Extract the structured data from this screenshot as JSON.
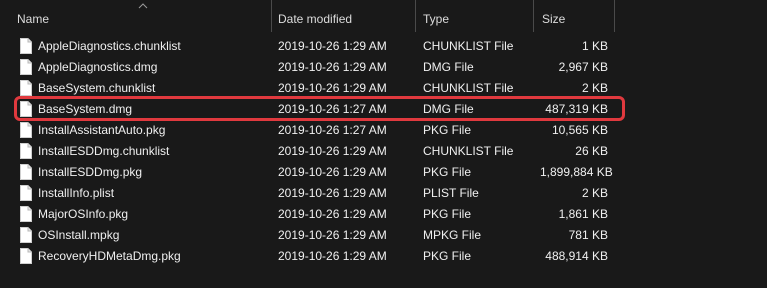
{
  "header": {
    "name": "Name",
    "date": "Date modified",
    "type": "Type",
    "size": "Size"
  },
  "files": [
    {
      "name": "AppleDiagnostics.chunklist",
      "date": "2019-10-26 1:29 AM",
      "type": "CHUNKLIST File",
      "size": "1 KB"
    },
    {
      "name": "AppleDiagnostics.dmg",
      "date": "2019-10-26 1:29 AM",
      "type": "DMG File",
      "size": "2,967 KB"
    },
    {
      "name": "BaseSystem.chunklist",
      "date": "2019-10-26 1:29 AM",
      "type": "CHUNKLIST File",
      "size": "2 KB"
    },
    {
      "name": "BaseSystem.dmg",
      "date": "2019-10-26 1:27 AM",
      "type": "DMG File",
      "size": "487,319 KB"
    },
    {
      "name": "InstallAssistantAuto.pkg",
      "date": "2019-10-26 1:27 AM",
      "type": "PKG File",
      "size": "10,565 KB"
    },
    {
      "name": "InstallESDDmg.chunklist",
      "date": "2019-10-26 1:29 AM",
      "type": "CHUNKLIST File",
      "size": "26 KB"
    },
    {
      "name": "InstallESDDmg.pkg",
      "date": "2019-10-26 1:29 AM",
      "type": "PKG File",
      "size": "1,899,884 KB"
    },
    {
      "name": "InstallInfo.plist",
      "date": "2019-10-26 1:29 AM",
      "type": "PLIST File",
      "size": "2 KB"
    },
    {
      "name": "MajorOSInfo.pkg",
      "date": "2019-10-26 1:29 AM",
      "type": "PKG File",
      "size": "1,861 KB"
    },
    {
      "name": "OSInstall.mpkg",
      "date": "2019-10-26 1:29 AM",
      "type": "MPKG File",
      "size": "781 KB"
    },
    {
      "name": "RecoveryHDMetaDmg.pkg",
      "date": "2019-10-26 1:29 AM",
      "type": "PKG File",
      "size": "488,914 KB"
    }
  ],
  "icons": {
    "file": "file-icon",
    "sort": "sort-up-icon"
  },
  "colors": {
    "background": "#191919",
    "highlight": "#e0393e",
    "text": "#f0f0f0"
  }
}
